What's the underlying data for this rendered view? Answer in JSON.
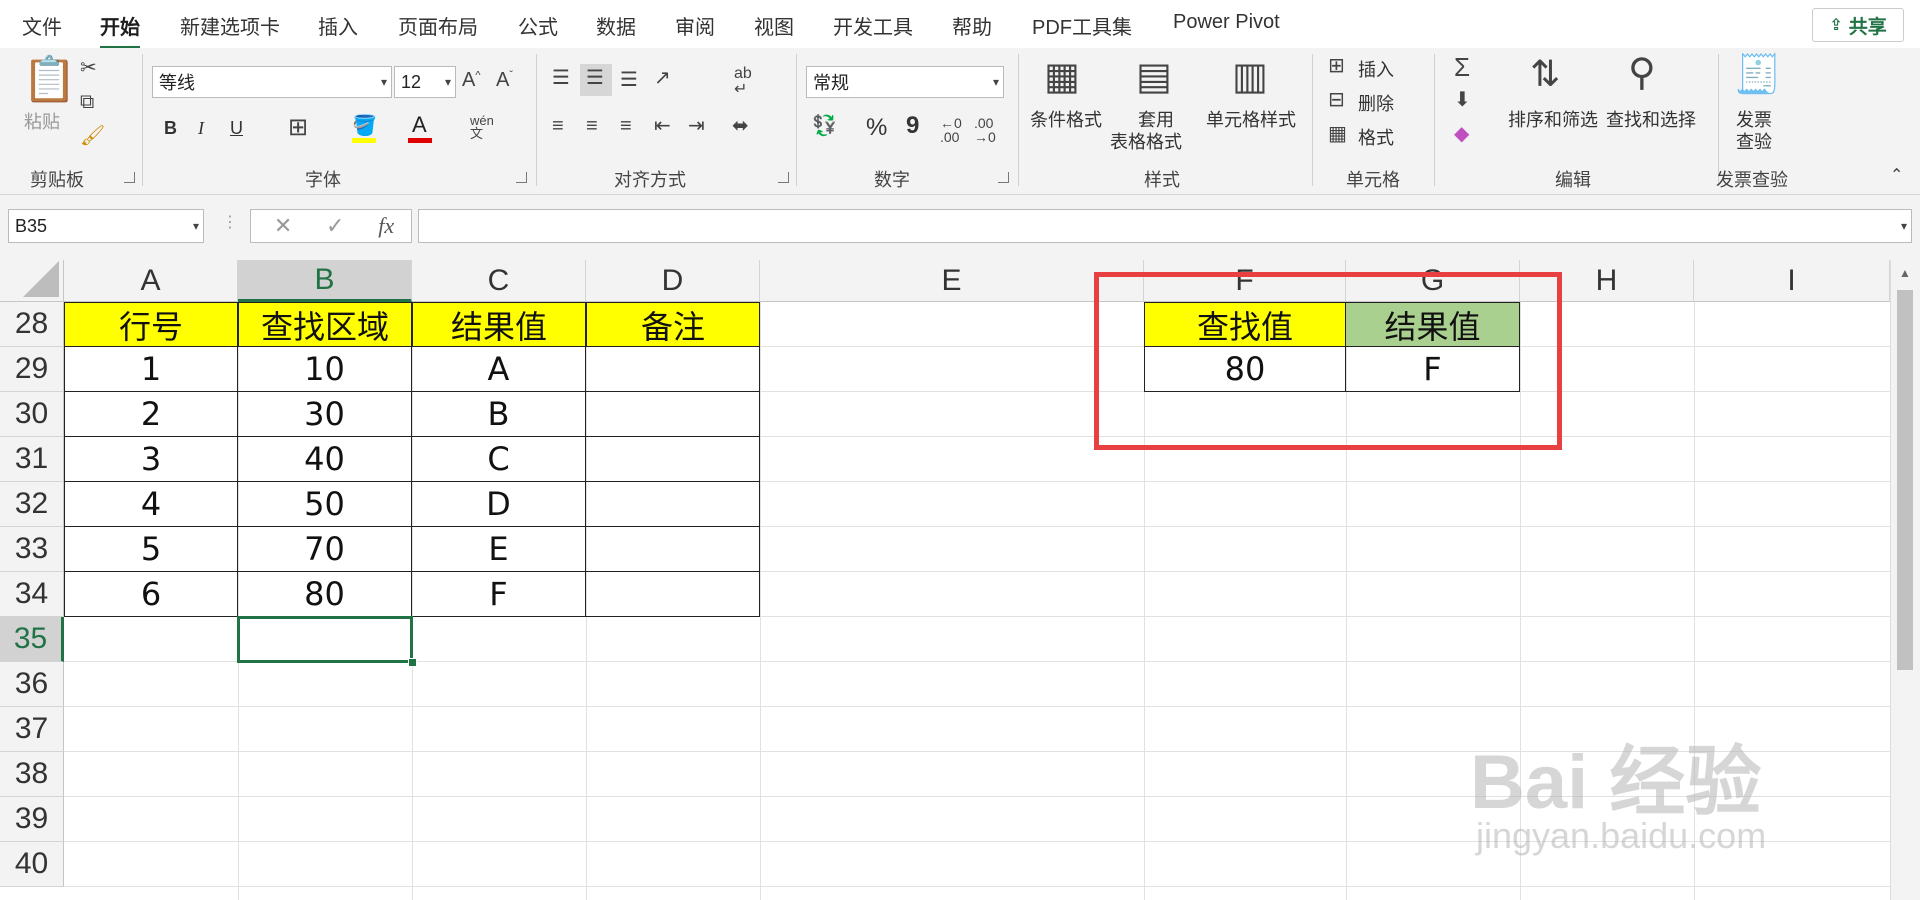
{
  "tabs": [
    "文件",
    "开始",
    "新建选项卡",
    "插入",
    "页面布局",
    "公式",
    "数据",
    "审阅",
    "视图",
    "开发工具",
    "帮助",
    "PDF工具集",
    "Power Pivot"
  ],
  "share_label": "共享",
  "ribbon": {
    "clipboard": {
      "paste": "粘贴",
      "group": "剪贴板"
    },
    "font": {
      "name": "等线",
      "size": "12",
      "bold": "B",
      "italic": "I",
      "underline": "U",
      "group": "字体"
    },
    "align": {
      "group": "对齐方式"
    },
    "number": {
      "format": "常规",
      "percent": "%",
      "comma": "9",
      "group": "数字"
    },
    "styles": {
      "cond": "条件格式",
      "table1": "套用",
      "table2": "表格格式",
      "cell": "单元格样式",
      "group": "样式"
    },
    "cells": {
      "insert": "插入",
      "delete": "删除",
      "format": "格式",
      "group": "单元格"
    },
    "edit": {
      "sort": "排序和筛选",
      "find": "查找和选择",
      "group": "编辑"
    },
    "invoice": {
      "line1": "发票",
      "line2": "查验",
      "group": "发票查验"
    }
  },
  "formula_bar": {
    "name_box": "B35",
    "cancel": "✕",
    "enter": "✓",
    "fx": "fx",
    "content": ""
  },
  "columns": [
    "A",
    "B",
    "C",
    "D",
    "E",
    "F",
    "G",
    "H",
    "I"
  ],
  "rows": [
    "28",
    "29",
    "30",
    "31",
    "32",
    "33",
    "34",
    "35",
    "36",
    "37",
    "38",
    "39",
    "40"
  ],
  "selected_cell": "B35",
  "table_main": {
    "headers": [
      "行号",
      "查找区域",
      "结果值",
      "备注"
    ],
    "rows": [
      [
        "1",
        "10",
        "A",
        ""
      ],
      [
        "2",
        "30",
        "B",
        ""
      ],
      [
        "3",
        "40",
        "C",
        ""
      ],
      [
        "4",
        "50",
        "D",
        ""
      ],
      [
        "5",
        "70",
        "E",
        ""
      ],
      [
        "6",
        "80",
        "F",
        ""
      ]
    ]
  },
  "table_lookup": {
    "headers": [
      "查找值",
      "结果值"
    ],
    "values": [
      "80",
      "F"
    ]
  },
  "colors": {
    "yellow": "#ffff00",
    "green_fill": "#a9d08e",
    "excel_green": "#217346",
    "highlight_red": "#e84040"
  },
  "watermark": {
    "line1": "Bai 经验",
    "line2": "jingyan.baidu.com"
  }
}
